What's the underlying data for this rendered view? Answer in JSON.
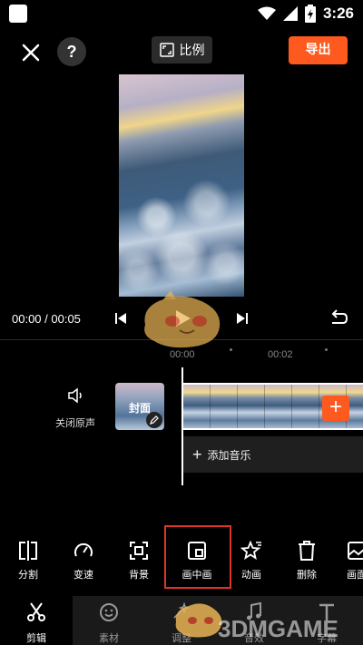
{
  "status_bar": {
    "time": "3:26"
  },
  "top_bar": {
    "ratio_label": "比例",
    "export_label": "导出",
    "help_label": "?"
  },
  "playback": {
    "time_readout": "00:00 / 00:05"
  },
  "ruler": {
    "tick_0": "00:00",
    "tick_1": "00:02"
  },
  "track": {
    "mute_label": "关闭原声",
    "cover_label": "封面",
    "add_music_label": "添加音乐",
    "add_clip_label": "+"
  },
  "tools": [
    {
      "label": "分割",
      "icon": "split-icon"
    },
    {
      "label": "变速",
      "icon": "speed-icon"
    },
    {
      "label": "背景",
      "icon": "background-icon"
    },
    {
      "label": "画中画",
      "icon": "picture-in-picture-icon"
    },
    {
      "label": "动画",
      "icon": "animation-icon"
    },
    {
      "label": "删除",
      "icon": "delete-icon"
    },
    {
      "label": "画面",
      "icon": "frame-icon"
    }
  ],
  "bottom_nav": [
    {
      "label": "剪辑",
      "icon": "scissors-icon"
    },
    {
      "label": "素材",
      "icon": "sticker-icon"
    },
    {
      "label": "调整",
      "icon": "adjust-icon"
    },
    {
      "label": "音效",
      "icon": "music-icon"
    },
    {
      "label": "字幕",
      "icon": "text-icon"
    }
  ],
  "watermark": {
    "text": "3DMGAME"
  },
  "colors": {
    "accent": "#fe5a1f",
    "highlight": "#e0332b"
  }
}
